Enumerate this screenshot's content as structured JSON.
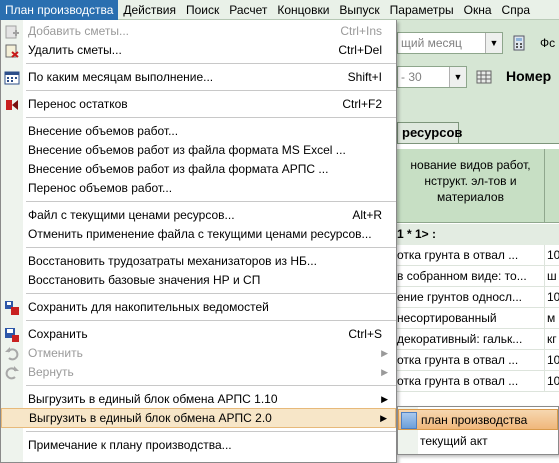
{
  "menubar": [
    {
      "label": "План производства",
      "active": true
    },
    {
      "label": "Действия"
    },
    {
      "label": "Поиск"
    },
    {
      "label": "Расчет"
    },
    {
      "label": "Концовки"
    },
    {
      "label": "Выпуск"
    },
    {
      "label": "Параметры"
    },
    {
      "label": "Окна"
    },
    {
      "label": "Спра"
    }
  ],
  "background": {
    "period_combo": "щий месяц",
    "date_combo": "- 30",
    "fo_label": "Фс",
    "nomer_label": "Номер",
    "resources_tab": "ресурсов",
    "grid_header": [
      "нование видов работ,",
      "нструкт. эл-тов и",
      "материалов"
    ],
    "group_row": "1 * 1> :",
    "rows": [
      {
        "c1": "отка грунта в отвал ...",
        "c2": "10"
      },
      {
        "c1": "в собранном виде: то...",
        "c2": "ш"
      },
      {
        "c1": "ение грунтов односл...",
        "c2": "10"
      },
      {
        "c1": "несортированный",
        "c2": "м"
      },
      {
        "c1": "декоративный: гальк...",
        "c2": "кг"
      },
      {
        "c1": "отка грунта в отвал ...",
        "c2": "10"
      },
      {
        "c1": "отка грунта в отвал ...",
        "c2": "10"
      }
    ]
  },
  "menu": [
    {
      "label": "Добавить сметы...",
      "shortcut": "Ctrl+Ins",
      "disabled": true,
      "icon": "add-estimate-icon"
    },
    {
      "label": "Удалить сметы...",
      "shortcut": "Ctrl+Del",
      "icon": "delete-estimate-icon"
    },
    {
      "label": "По каким месяцам выполнение...",
      "shortcut": "Shift+I",
      "icon": "calendar-icon"
    },
    {
      "label": "Перенос остатков",
      "shortcut": "Ctrl+F2",
      "icon": "transfer-icon"
    },
    {
      "label": "Внесение объемов работ..."
    },
    {
      "label": "Внесение объемов работ из файла формата MS Excel ..."
    },
    {
      "label": "Внесение объемов работ из файла формата АРПС ..."
    },
    {
      "label": "Перенос объемов работ..."
    },
    {
      "label": "Файл с текущими ценами ресурсов...",
      "shortcut": "Alt+R"
    },
    {
      "label": "Отменить применение файла с текущими ценами ресурсов..."
    },
    {
      "label": "Восстановить трудозатраты механизаторов из НБ..."
    },
    {
      "label": "Восстановить базовые значения НР и СП"
    },
    {
      "label": "Сохранить для накопительных ведомостей",
      "icon": "save-cumulative-icon"
    },
    {
      "label": "Сохранить",
      "shortcut": "Ctrl+S",
      "icon": "save-icon"
    },
    {
      "label": "Отменить",
      "disabled": true,
      "submenu": true,
      "icon": "undo-icon"
    },
    {
      "label": "Вернуть",
      "disabled": true,
      "submenu": true,
      "icon": "redo-icon"
    },
    {
      "label": "Выгрузить в единый блок обмена АРПС 1.10",
      "submenu": true
    },
    {
      "label": "Выгрузить в единый блок обмена АРПС 2.0",
      "submenu": true,
      "hover": true
    },
    {
      "label": "Примечание к плану производства..."
    }
  ],
  "submenu": [
    {
      "label": "план производства",
      "hover": true
    },
    {
      "label": "текущий акт"
    }
  ]
}
